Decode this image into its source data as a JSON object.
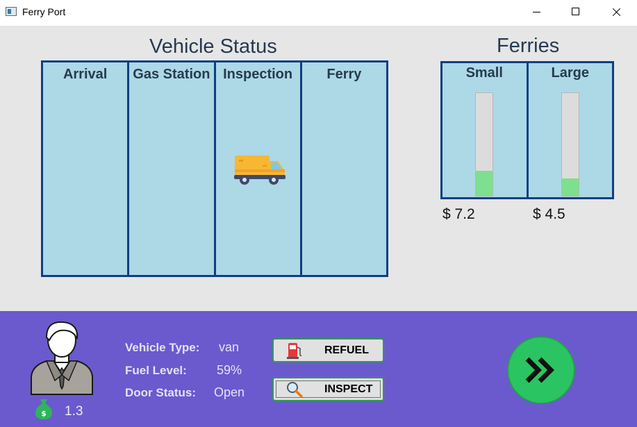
{
  "window": {
    "title": "Ferry Port"
  },
  "vehicle_status": {
    "title": "Vehicle Status",
    "columns": [
      "Arrival",
      "Gas Station",
      "Inspection",
      "Ferry"
    ],
    "current_vehicle_column": "Inspection",
    "current_vehicle_icon": "van-icon"
  },
  "ferries": {
    "title": "Ferries",
    "items": [
      {
        "name": "Small",
        "price": "$ 7.2",
        "fill_fraction": 0.24
      },
      {
        "name": "Large",
        "price": "$ 4.5",
        "fill_fraction": 0.17
      }
    ]
  },
  "player": {
    "avatar_icon": "businessman-avatar-icon",
    "money_icon": "money-bag-icon",
    "money": "1.3"
  },
  "vehicle_info": {
    "type_label": "Vehicle Type:",
    "type_value": "van",
    "fuel_label": "Fuel Level:",
    "fuel_value": "59%",
    "door_label": "Door Status:",
    "door_value": "Open"
  },
  "actions": {
    "refuel_label": "REFUEL",
    "refuel_icon": "fuel-pump-icon",
    "inspect_label": "INSPECT",
    "inspect_icon": "magnifier-icon",
    "next_icon": "fast-forward-icon"
  },
  "colors": {
    "column_bg": "#add8e6",
    "border": "#0e3f82",
    "panel": "#6a5acd",
    "button_border": "#2e9c4e",
    "next_button": "#2bc462",
    "gauge_fill": "#7de08e"
  }
}
